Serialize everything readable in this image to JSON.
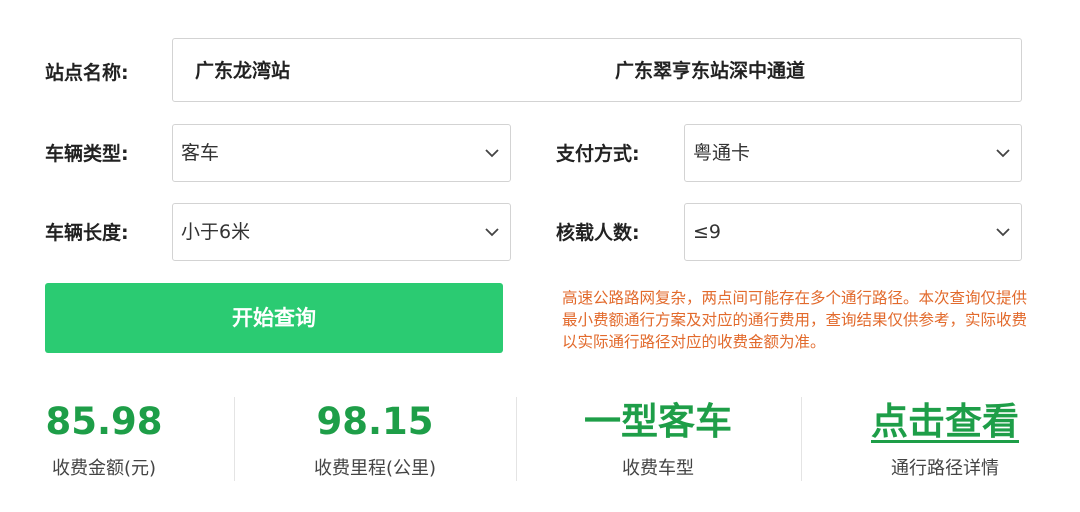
{
  "form": {
    "station_label": "站点名称:",
    "station_from": "广东龙湾站",
    "station_to": "广东翠亨东站深中通道",
    "vehicle_type_label": "车辆类型:",
    "vehicle_type_value": "客车",
    "payment_label": "支付方式:",
    "payment_value": "粤通卡",
    "vehicle_length_label": "车辆长度:",
    "vehicle_length_value": "小于6米",
    "capacity_label": "核载人数:",
    "capacity_value": "≤9",
    "query_button": "开始查询"
  },
  "notice": "高速公路路网复杂，两点间可能存在多个通行路径。本次查询仅提供最小费额通行方案及对应的通行费用，查询结果仅供参考，实际收费以实际通行路径对应的收费金额为准。",
  "results": {
    "fee_value": "85.98",
    "fee_label": "收费金额(元)",
    "distance_value": "98.15",
    "distance_label": "收费里程(公里)",
    "vehicle_class_value": "一型客车",
    "vehicle_class_label": "收费车型",
    "route_link": "点击查看",
    "route_label": "通行路径详情"
  },
  "colors": {
    "accent_green": "#2bcb72",
    "result_green": "#1e9e48",
    "notice_orange": "#e26a2c"
  },
  "icons": {
    "select_arrow": "chevron-down-icon"
  }
}
